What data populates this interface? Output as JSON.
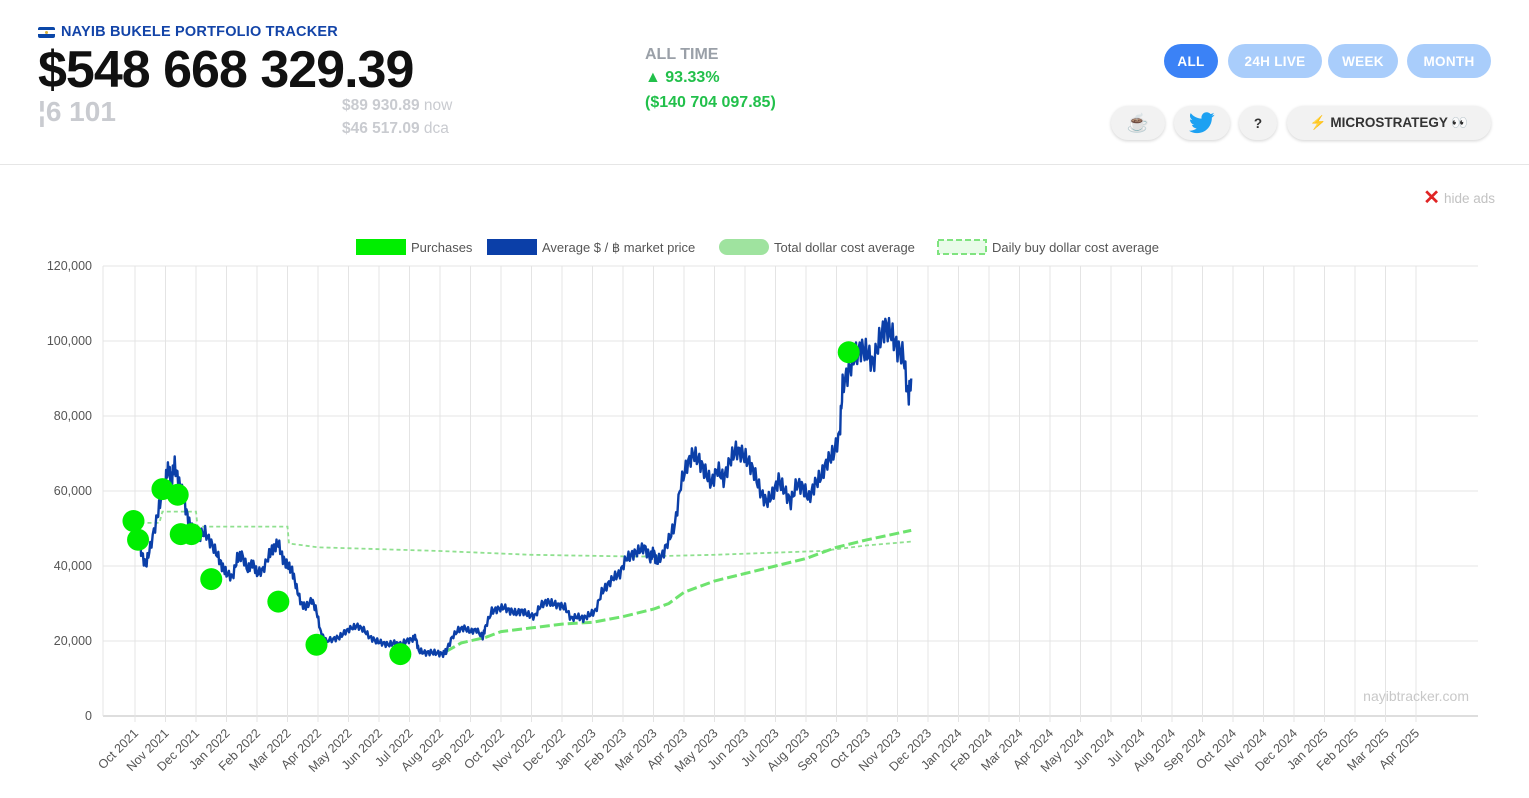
{
  "header": {
    "brand": "NAYIB BUKELE PORTFOLIO TRACKER",
    "total_value": "$548 668 329.39",
    "btc_amount": "¦6 101",
    "price_now": "$89 930.89",
    "price_now_suffix": "now",
    "price_dca": "$46 517.09",
    "price_dca_suffix": "dca",
    "alltime_label": "ALL TIME",
    "alltime_pct": "▲ 93.33%",
    "alltime_abs": "($140 704 097.85)",
    "accent_color": "#3b82f6",
    "positive_color": "#22c04b"
  },
  "range_buttons": [
    {
      "label": "ALL",
      "active": true
    },
    {
      "label": "24H LIVE",
      "active": false
    },
    {
      "label": "WEEK",
      "active": false
    },
    {
      "label": "MONTH",
      "active": false
    }
  ],
  "actions": {
    "coffee": "☕",
    "twitter_icon": "twitter-bird",
    "help": "?",
    "microstrategy": "⚡ MICROSTRATEGY 👀"
  },
  "ads": {
    "hide_label": "hide ads",
    "close_icon": "✕"
  },
  "chart_data": {
    "type": "line",
    "legend": [
      {
        "name": "Purchases",
        "color": "#00ee00"
      },
      {
        "name": "Average $ / ฿ market price",
        "color": "#0b3fa8"
      },
      {
        "name": "Total dollar cost average",
        "color": "#8fe08f"
      },
      {
        "name": "Daily buy dollar cost average",
        "color": "#7fe37f"
      }
    ],
    "legend_position": "top",
    "y_ticks": [
      "0",
      "20,000",
      "40,000",
      "60,000",
      "80,000",
      "100,000",
      "120,000"
    ],
    "ylim": [
      0,
      120000
    ],
    "x_ticks": [
      "Oct 2021",
      "Nov 2021",
      "Dec 2021",
      "Jan 2022",
      "Feb 2022",
      "Mar 2022",
      "Apr 2022",
      "May 2022",
      "Jun 2022",
      "Jul 2022",
      "Aug 2022",
      "Sep 2022",
      "Oct 2022",
      "Nov 2022",
      "Dec 2022",
      "Jan 2023",
      "Feb 2023",
      "Mar 2023",
      "Apr 2023",
      "May 2023",
      "Jun 2023",
      "Jul 2023",
      "Aug 2023",
      "Sep 2023",
      "Oct 2023",
      "Nov 2023",
      "Dec 2023",
      "Jan 2024",
      "Feb 2024",
      "Mar 2024",
      "Apr 2024",
      "May 2024",
      "Jun 2024",
      "Jul 2024",
      "Aug 2024",
      "Sep 2024",
      "Oct 2024",
      "Nov 2024",
      "Dec 2024",
      "Jan 2025",
      "Feb 2025",
      "Mar 2025",
      "Apr 2025"
    ],
    "grid": true,
    "watermark": "nayibtracker.com",
    "series": [
      {
        "name": "Average $ / ฿ market price",
        "points": [
          [
            -0.05,
            52000
          ],
          [
            0.1,
            49000
          ],
          [
            0.2,
            44000
          ],
          [
            0.35,
            40000
          ],
          [
            0.5,
            45000
          ],
          [
            0.7,
            52000
          ],
          [
            0.85,
            58000
          ],
          [
            1.0,
            63000
          ],
          [
            1.1,
            66000
          ],
          [
            1.2,
            63000
          ],
          [
            1.3,
            67000
          ],
          [
            1.45,
            62000
          ],
          [
            1.6,
            58000
          ],
          [
            1.75,
            52000
          ],
          [
            1.9,
            49000
          ],
          [
            2.1,
            48000
          ],
          [
            2.3,
            49000
          ],
          [
            2.5,
            46000
          ],
          [
            2.7,
            43000
          ],
          [
            2.85,
            40000
          ],
          [
            3.0,
            38000
          ],
          [
            3.2,
            37000
          ],
          [
            3.35,
            42000
          ],
          [
            3.5,
            43000
          ],
          [
            3.7,
            39000
          ],
          [
            3.85,
            41000
          ],
          [
            4.0,
            38000
          ],
          [
            4.2,
            39000
          ],
          [
            4.4,
            43000
          ],
          [
            4.55,
            45000
          ],
          [
            4.7,
            46000
          ],
          [
            4.85,
            42000
          ],
          [
            5.0,
            40000
          ],
          [
            5.15,
            39000
          ],
          [
            5.3,
            34000
          ],
          [
            5.45,
            30000
          ],
          [
            5.6,
            29000
          ],
          [
            5.8,
            31000
          ],
          [
            5.95,
            28000
          ],
          [
            6.1,
            22000
          ],
          [
            6.25,
            20000
          ],
          [
            6.5,
            20500
          ],
          [
            6.7,
            21000
          ],
          [
            6.9,
            22500
          ],
          [
            7.1,
            23500
          ],
          [
            7.3,
            24000
          ],
          [
            7.5,
            23000
          ],
          [
            7.7,
            21000
          ],
          [
            7.9,
            20000
          ],
          [
            8.1,
            19500
          ],
          [
            8.3,
            19000
          ],
          [
            8.5,
            19500
          ],
          [
            8.7,
            19000
          ],
          [
            8.9,
            20000
          ],
          [
            9.1,
            20500
          ],
          [
            9.2,
            21000
          ],
          [
            9.3,
            17500
          ],
          [
            9.5,
            16800
          ],
          [
            9.7,
            17000
          ],
          [
            9.9,
            16800
          ],
          [
            10.1,
            16500
          ],
          [
            10.2,
            17200
          ],
          [
            10.4,
            21000
          ],
          [
            10.6,
            23000
          ],
          [
            10.8,
            23500
          ],
          [
            11.0,
            22500
          ],
          [
            11.2,
            23000
          ],
          [
            11.4,
            21000
          ],
          [
            11.5,
            24000
          ],
          [
            11.7,
            28000
          ],
          [
            11.9,
            28500
          ],
          [
            12.1,
            29000
          ],
          [
            12.3,
            28000
          ],
          [
            12.5,
            27500
          ],
          [
            12.7,
            28000
          ],
          [
            12.9,
            27000
          ],
          [
            13.1,
            26500
          ],
          [
            13.3,
            29500
          ],
          [
            13.5,
            30500
          ],
          [
            13.7,
            30000
          ],
          [
            13.9,
            29500
          ],
          [
            14.1,
            29000
          ],
          [
            14.3,
            26000
          ],
          [
            14.5,
            26500
          ],
          [
            14.7,
            26000
          ],
          [
            14.9,
            27000
          ],
          [
            15.1,
            28000
          ],
          [
            15.3,
            33000
          ],
          [
            15.5,
            35000
          ],
          [
            15.7,
            37000
          ],
          [
            15.9,
            38000
          ],
          [
            16.1,
            42000
          ],
          [
            16.3,
            43000
          ],
          [
            16.5,
            44000
          ],
          [
            16.7,
            45000
          ],
          [
            16.9,
            42000
          ],
          [
            17.0,
            44000
          ],
          [
            17.1,
            41000
          ],
          [
            17.3,
            43000
          ],
          [
            17.5,
            47000
          ],
          [
            17.7,
            51000
          ],
          [
            17.9,
            62000
          ],
          [
            18.1,
            67000
          ],
          [
            18.3,
            70000
          ],
          [
            18.5,
            68000
          ],
          [
            18.7,
            65000
          ],
          [
            18.9,
            62000
          ],
          [
            19.1,
            66000
          ],
          [
            19.3,
            63000
          ],
          [
            19.5,
            68000
          ],
          [
            19.7,
            71000
          ],
          [
            19.9,
            70000
          ],
          [
            20.1,
            68000
          ],
          [
            20.3,
            65000
          ],
          [
            20.5,
            60000
          ],
          [
            20.7,
            57000
          ],
          [
            20.9,
            59000
          ],
          [
            21.1,
            63000
          ],
          [
            21.3,
            60000
          ],
          [
            21.5,
            57000
          ],
          [
            21.7,
            62000
          ],
          [
            21.9,
            61000
          ],
          [
            22.1,
            58000
          ],
          [
            22.3,
            62000
          ],
          [
            22.5,
            64000
          ],
          [
            22.7,
            68000
          ],
          [
            22.9,
            70000
          ],
          [
            23.1,
            75000
          ],
          [
            23.2,
            88000
          ],
          [
            23.4,
            92000
          ],
          [
            23.6,
            96000
          ],
          [
            23.8,
            98000
          ],
          [
            24.0,
            97000
          ],
          [
            24.2,
            94000
          ],
          [
            24.4,
            100000
          ],
          [
            24.6,
            104000
          ],
          [
            24.8,
            102000
          ],
          [
            25.0,
            98000
          ],
          [
            25.2,
            96000
          ],
          [
            25.35,
            85000
          ],
          [
            25.45,
            90000
          ]
        ]
      },
      {
        "name": "Total dollar cost average",
        "points": [
          [
            -0.05,
            51500
          ],
          [
            0.8,
            51500
          ],
          [
            0.9,
            54500
          ],
          [
            2.0,
            54500
          ],
          [
            2.05,
            50500
          ],
          [
            5.0,
            50500
          ],
          [
            5.05,
            46000
          ],
          [
            6.0,
            45000
          ],
          [
            10.0,
            44000
          ],
          [
            13.0,
            43000
          ],
          [
            16.5,
            42500
          ],
          [
            19.0,
            43000
          ],
          [
            22.5,
            44000
          ],
          [
            24.0,
            45500
          ],
          [
            25.45,
            46500
          ]
        ]
      },
      {
        "name": "Daily buy dollar cost average",
        "points": [
          [
            10.2,
            17200
          ],
          [
            10.7,
            19500
          ],
          [
            11.5,
            21000
          ],
          [
            12.0,
            22500
          ],
          [
            13.0,
            23500
          ],
          [
            14.0,
            24500
          ],
          [
            15.0,
            25000
          ],
          [
            16.0,
            26500
          ],
          [
            17.0,
            28500
          ],
          [
            17.5,
            30000
          ],
          [
            18.0,
            33000
          ],
          [
            19.0,
            36000
          ],
          [
            20.0,
            38000
          ],
          [
            21.0,
            40000
          ],
          [
            22.0,
            42000
          ],
          [
            23.0,
            45000
          ],
          [
            24.0,
            47000
          ],
          [
            25.45,
            49500
          ]
        ]
      }
    ],
    "purchases": [
      [
        -0.05,
        52000
      ],
      [
        0.1,
        47000
      ],
      [
        0.9,
        60500
      ],
      [
        1.4,
        59000
      ],
      [
        1.5,
        48500
      ],
      [
        1.85,
        48500
      ],
      [
        2.5,
        36500
      ],
      [
        4.7,
        30500
      ],
      [
        5.95,
        19000
      ],
      [
        8.7,
        16500
      ],
      [
        23.4,
        97000
      ]
    ]
  }
}
